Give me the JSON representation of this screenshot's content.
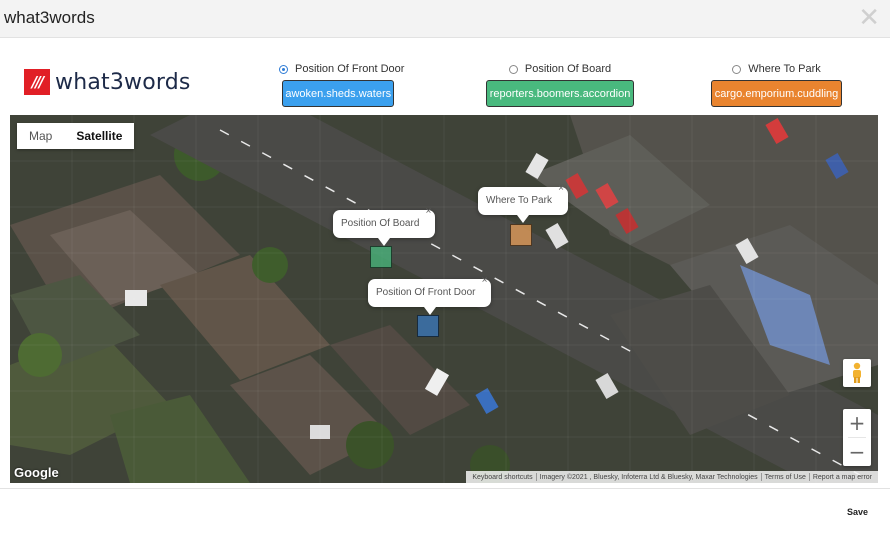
{
  "dialog": {
    "title": "what3words",
    "close_icon": "close-icon"
  },
  "logo": {
    "mark": "///",
    "text": "what3words",
    "brand_color": "#e11f26"
  },
  "options": [
    {
      "label": "Position Of Front Door",
      "checked": true,
      "chip": "awoken.sheds.waters",
      "color": "#3ba0ee"
    },
    {
      "label": "Position Of Board",
      "checked": false,
      "chip": "reporters.boomers.accordion",
      "color": "#49b97e"
    },
    {
      "label": "Where To Park",
      "checked": false,
      "chip": "cargo.emporium.cuddling",
      "color": "#e9842f"
    }
  ],
  "map": {
    "type_buttons": [
      "Map",
      "Satellite"
    ],
    "active_type": "Satellite",
    "bubbles": {
      "front_door": "Position Of Front Door",
      "board": "Position Of Board",
      "park": "Where To Park"
    },
    "bubble_close": "×",
    "zoom_in": "+",
    "zoom_out": "−",
    "google_label": "Google",
    "attribution": [
      "Keyboard shortcuts",
      "Imagery ©2021 , Bluesky, Infoterra Ltd & Bluesky, Maxar Technologies",
      "Terms of Use",
      "Report a map error"
    ],
    "pegman_icon": "pegman-icon"
  },
  "footer": {
    "save_label": "Save"
  }
}
